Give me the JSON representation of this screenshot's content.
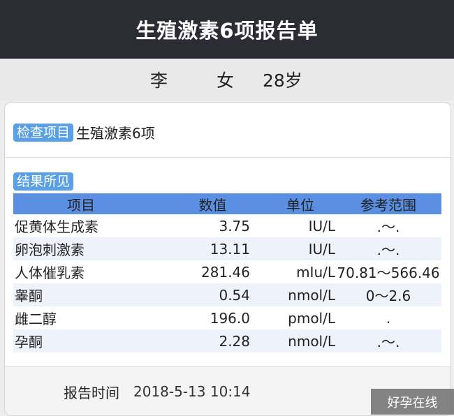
{
  "header": {
    "title": "生殖激素6项报告单"
  },
  "patient": {
    "name": "李",
    "gender": "女",
    "age": "28岁"
  },
  "exam": {
    "tag": "检查项目",
    "value": "生殖激素6项"
  },
  "results": {
    "tag": "结果所见",
    "columns": [
      "项目",
      "数值",
      "单位",
      "参考范围"
    ],
    "rows": [
      [
        "促黄体生成素",
        "3.75",
        "IU/L",
        ".～."
      ],
      [
        "卵泡刺激素",
        "13.11",
        "IU/L",
        ".～."
      ],
      [
        "人体催乳素",
        "281.46",
        "mIu/L",
        "70.81～566.46"
      ],
      [
        "睾酮",
        "0.54",
        "nmol/L",
        "0～2.6"
      ],
      [
        "雌二醇",
        "196.0",
        "pmol/L",
        "."
      ],
      [
        "孕酮",
        "2.28",
        "nmol/L",
        ".～."
      ]
    ]
  },
  "footer": {
    "label": "报告时间",
    "time": "2018-5-13 10:14"
  },
  "watermark": "好孕在线",
  "colors": {
    "header_bg": "#2c2c35",
    "accent": "#5aa0e6",
    "table_header": "#5a8fe3"
  }
}
